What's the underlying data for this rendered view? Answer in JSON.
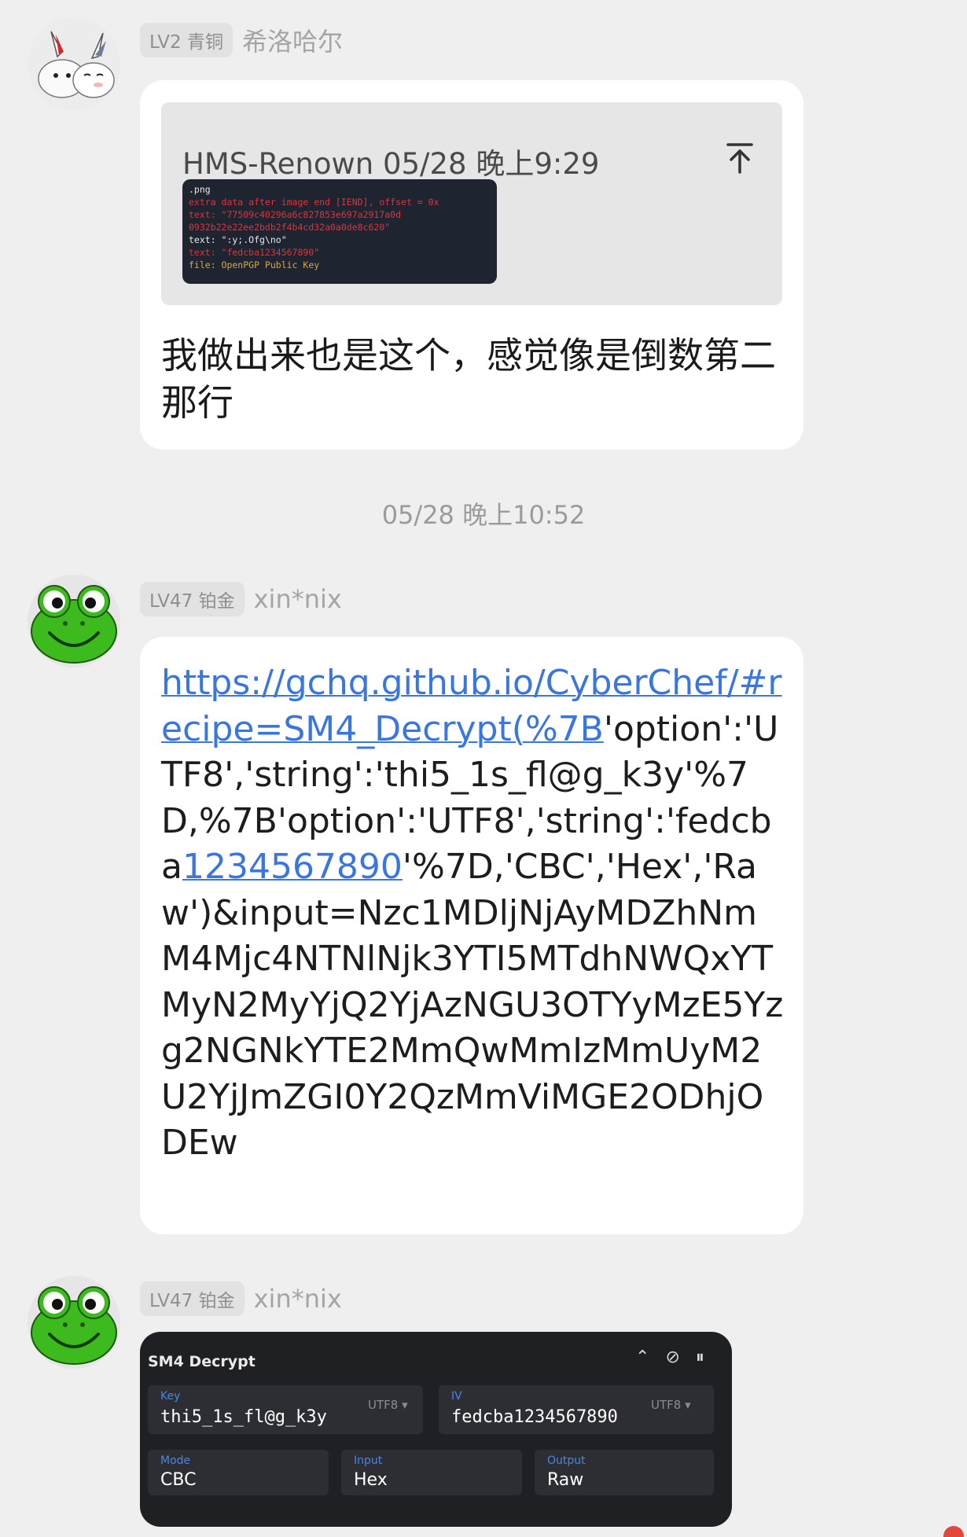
{
  "messages": [
    {
      "level": "LV2 青铜",
      "name": "希洛哈尔",
      "quote": {
        "header": "HMS-Renown 05/28 晚上9:29",
        "thumb_lines": [
          ".png",
          "extra data after image end [IEND], offset = 0x",
          "  text: \"77509c40296a6c827853e697a2917a0d",
          "0932b22e22ee2bdb2f4b4cd32a0a0de8c620\"",
          "  text: \":y;.Ofg\\no\"",
          "  text: \"fedcba1234567890\"",
          "  file: OpenPGP Public Key"
        ]
      },
      "text": "我做出来也是这个，感觉像是倒数第二那行"
    },
    {
      "level": "LV47 铂金",
      "name": "xin*nix",
      "segments": [
        {
          "text": "https://gchq.github.io/CyberChef/#recipe=SM4_Decrypt(%7B",
          "link": true
        },
        {
          "text": "'option':'UTF8','string':'thi5_1s_fl@g_k3y'%7D,%7B'option':'UTF8','string':'fedcba",
          "link": false
        },
        {
          "text": "1234567890",
          "link": true
        },
        {
          "text": "'%7D,'CBC','Hex','Raw')&input=Nzc1MDljNjAyMDZhNmM4Mjc4NTNlNjk3YTI5MTdhNWQxYTMyN2MyYjQ2YjAzNGU3OTYyMzE5Yzg2NGNkYTE2MmQwMmIzMmUyM2U2YjJmZGI0Y2QzMmViMGE2ODhjODEw",
          "link": false
        }
      ]
    },
    {
      "level": "LV47 铂金",
      "name": "xin*nix",
      "operation": {
        "title": "SM4 Decrypt",
        "key_label": "Key",
        "key_value": "thi5_1s_fl@g_k3y",
        "key_encoding": "UTF8 ▾",
        "iv_label": "IV",
        "iv_value": "fedcba1234567890",
        "iv_encoding": "UTF8 ▾",
        "mode_label": "Mode",
        "mode_value": "CBC",
        "input_label": "Input",
        "input_value": "Hex",
        "output_label": "Output",
        "output_value": "Raw",
        "icon_up": "⌃",
        "icon_disable": "⊘",
        "icon_pause": "⏸"
      }
    }
  ],
  "timestamp": "05/28 晚上10:52",
  "icons": {
    "pin_top": "pin-to-top-icon",
    "avatar_rabbits": "rabbit-avatar",
    "avatar_frog": "frog-avatar"
  }
}
